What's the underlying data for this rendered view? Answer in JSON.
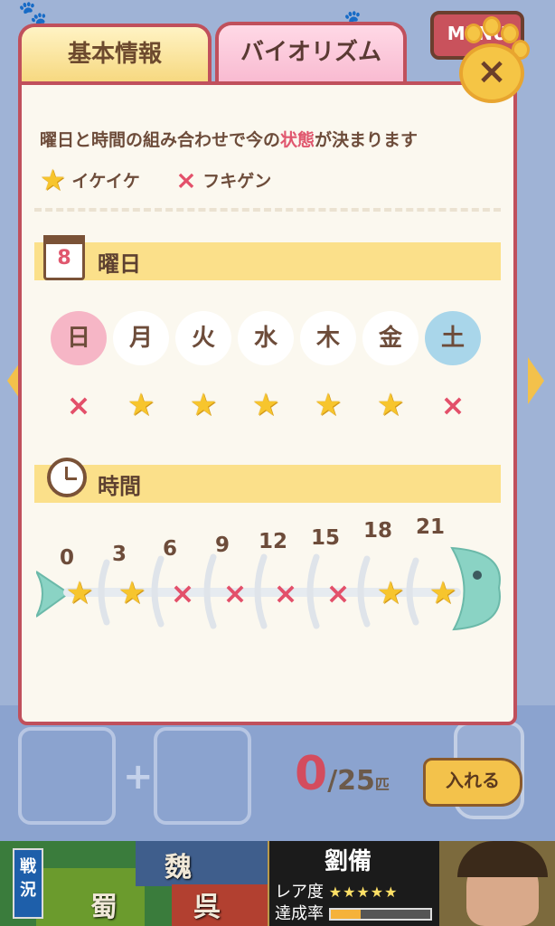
{
  "header": {
    "menu_label": "MENU"
  },
  "tabs": [
    {
      "label": "基本情報",
      "active": false
    },
    {
      "label": "バイオリズム",
      "active": true
    }
  ],
  "close_button": {
    "label": "×"
  },
  "description": {
    "before": "曜日と時間の組み合わせで今の",
    "highlight": "状態",
    "after": "が決まります"
  },
  "legend": {
    "good": {
      "symbol": "★",
      "label": "イケイケ"
    },
    "bad": {
      "symbol": "×",
      "label": "フキゲン"
    }
  },
  "weekday_section": {
    "title": "曜日",
    "icon_text": "8",
    "days": [
      {
        "label": "日",
        "state": "bad"
      },
      {
        "label": "月",
        "state": "good"
      },
      {
        "label": "火",
        "state": "good"
      },
      {
        "label": "水",
        "state": "good"
      },
      {
        "label": "木",
        "state": "good"
      },
      {
        "label": "金",
        "state": "good"
      },
      {
        "label": "土",
        "state": "bad"
      }
    ]
  },
  "time_section": {
    "title": "時間",
    "slots": [
      {
        "hour": "0",
        "state": "good"
      },
      {
        "hour": "3",
        "state": "good"
      },
      {
        "hour": "6",
        "state": "bad"
      },
      {
        "hour": "9",
        "state": "bad"
      },
      {
        "hour": "12",
        "state": "bad"
      },
      {
        "hour": "15",
        "state": "bad"
      },
      {
        "hour": "18",
        "state": "good"
      },
      {
        "hour": "21",
        "state": "good"
      }
    ]
  },
  "tray": {
    "count_current": "0",
    "count_total": "/25",
    "count_unit": "匹",
    "insert_label": "入れる"
  },
  "banner": {
    "tag": "戦況",
    "kingdoms": [
      "魏",
      "蜀",
      "呉"
    ],
    "hero_name": "劉備",
    "rarity_label": "レア度",
    "rarity_stars": "★★★★★",
    "achieve_label": "達成率",
    "achieve_fraction": 0.3
  },
  "colors": {
    "good": "#f7c52d",
    "bad": "#e3506a",
    "frame": "#c0505c",
    "section": "#fbe08a"
  },
  "icons": {
    "good": "star-icon",
    "bad": "x-mark-icon",
    "calendar": "calendar-icon",
    "clock": "clock-icon",
    "close": "paw-close-icon"
  }
}
